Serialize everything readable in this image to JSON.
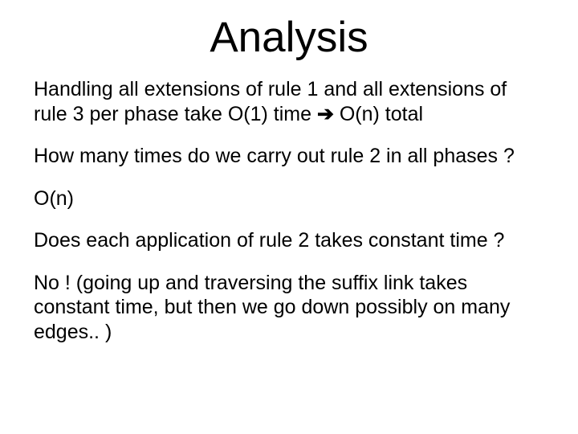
{
  "title": "Analysis",
  "para1_a": "Handling all extensions of rule 1 and all extensions of rule 3 per phase take O(1) time ",
  "arrow": "➔",
  "para1_b": " O(n) total",
  "para2": "How many times do we carry out rule 2 in all phases ?",
  "para3": "O(n)",
  "para4": "Does each application of rule 2 takes constant time ?",
  "para5": "No !   (going up and traversing the suffix link takes constant time, but then we go down possibly on many edges.. )"
}
